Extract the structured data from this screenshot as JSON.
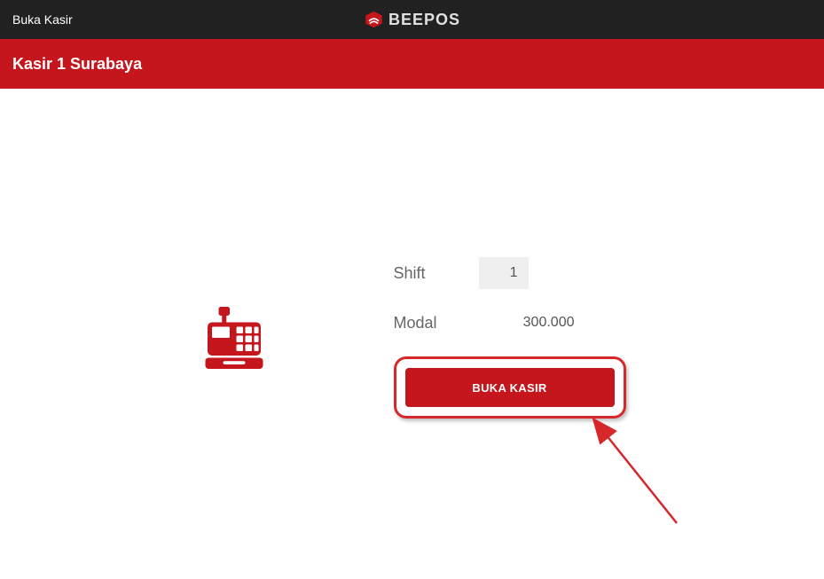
{
  "topbar": {
    "page_title": "Buka Kasir",
    "brand": "BEEPOS"
  },
  "subheader": {
    "title": "Kasir 1 Surabaya"
  },
  "form": {
    "shift_label": "Shift",
    "shift_value": "1",
    "modal_label": "Modal",
    "modal_value": "300.000"
  },
  "actions": {
    "open_register": "BUKA KASIR"
  },
  "colors": {
    "brand_red": "#c4161c",
    "topbar_bg": "#212121"
  }
}
